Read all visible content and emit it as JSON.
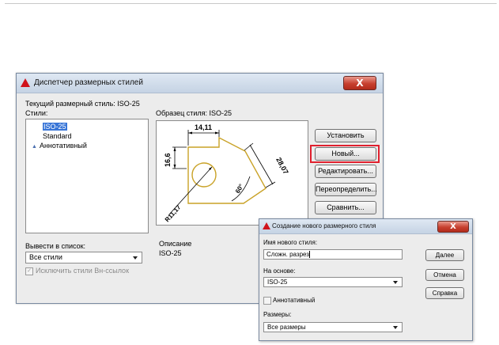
{
  "colors": {
    "highlight": "#e0202e",
    "drawing": "#c9a227",
    "selection": "#3875d7"
  },
  "main_dialog": {
    "title": "Диспетчер размерных стилей",
    "close_label": "X",
    "current_style_label": "Текущий размерный стиль: ISO-25",
    "styles_label": "Стили:",
    "styles": [
      {
        "name": "ISO-25",
        "selected": true
      },
      {
        "name": "Standard",
        "selected": false
      },
      {
        "name": "Аннотативный",
        "selected": false,
        "icon": "annotative-icon"
      }
    ],
    "annotative_glyph": "▲",
    "preview_label": "Образец стиля: ISO-25",
    "preview_dims": {
      "top": "14,11",
      "left": "16,6",
      "diag": "28,07",
      "angle": "60°",
      "radius": "R11,17"
    },
    "buttons": {
      "set": "Установить",
      "new": "Новый...",
      "edit": "Редактировать...",
      "override": "Переопределить...",
      "compare": "Сравнить..."
    },
    "list_label": "Вывести в список:",
    "list_value": "Все стили",
    "exclude_label": "Исключить стили Вн-ссылок",
    "check_glyph": "✓",
    "description_label": "Описание",
    "description_value": "ISO-25"
  },
  "new_style_dialog": {
    "title": "Создание нового размерного стиля",
    "close_label": "X",
    "name_label": "Имя нового стиля:",
    "name_value": "Сложн. разрез",
    "base_label": "На основе:",
    "base_value": "ISO-25",
    "annotative_label": "Аннотативный",
    "use_for_label": "Размеры:",
    "use_for_value": "Все размеры",
    "buttons": {
      "continue": "Далее",
      "cancel": "Отмена",
      "help": "Справка"
    }
  }
}
